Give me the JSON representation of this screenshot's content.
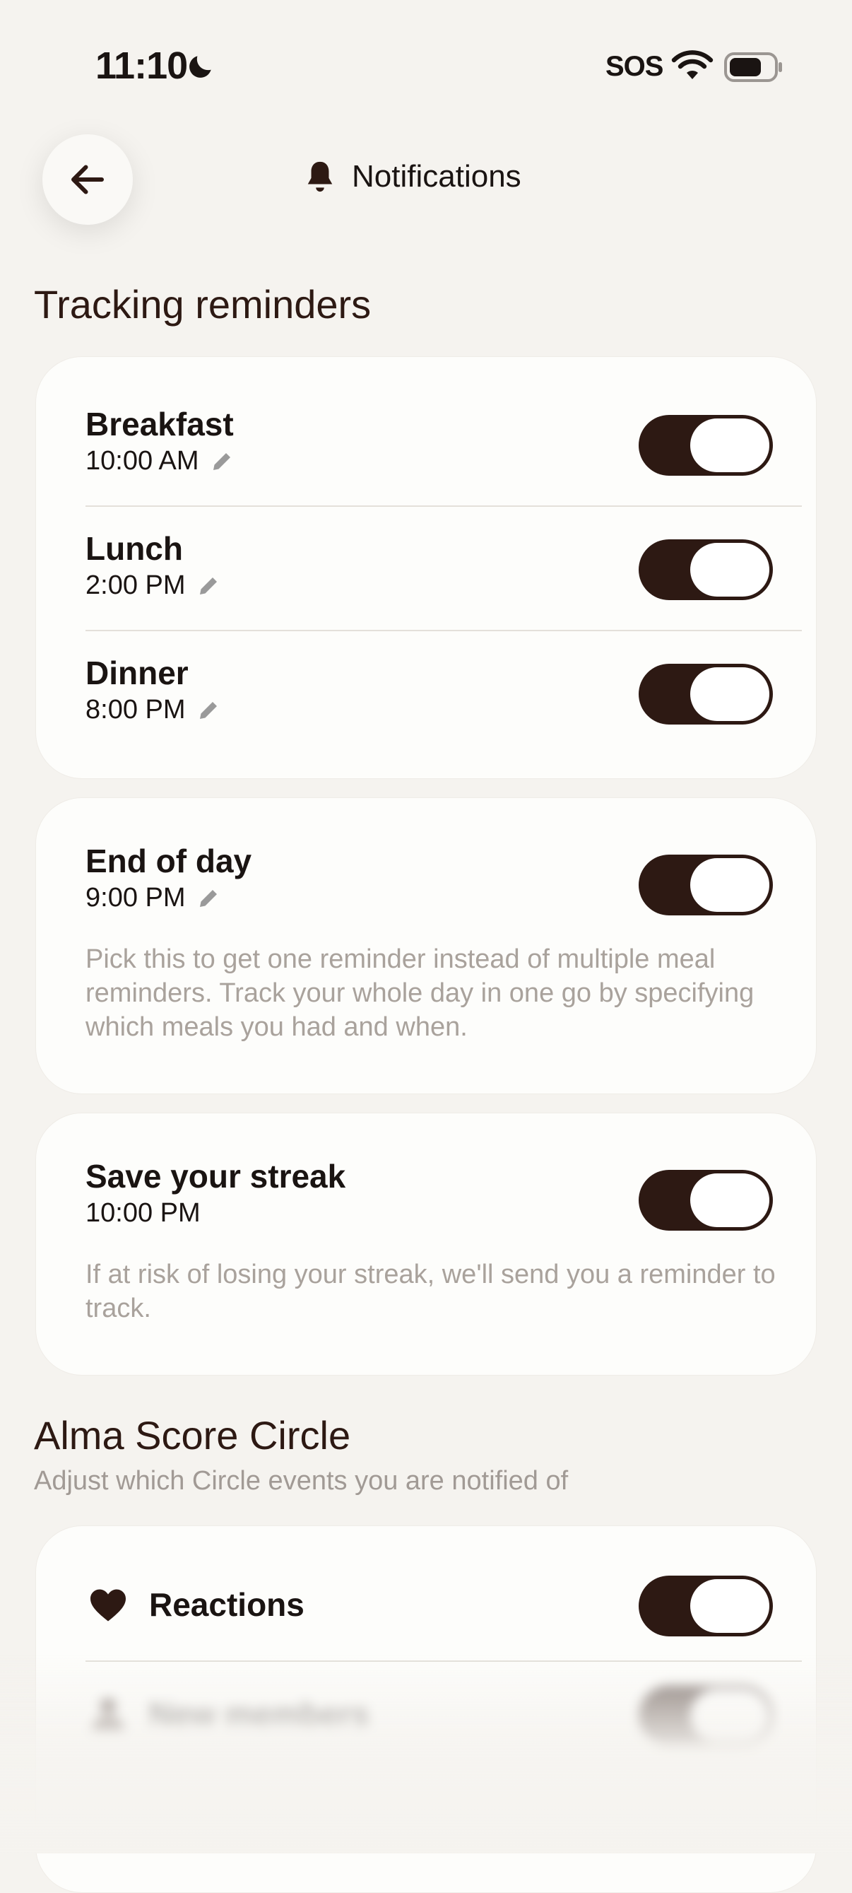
{
  "status_bar": {
    "time": "11:10",
    "sos": "SOS"
  },
  "header": {
    "title": "Notifications",
    "back_icon": "arrow-left-icon",
    "bell_icon": "bell-icon"
  },
  "tracking": {
    "heading": "Tracking reminders",
    "meals": [
      {
        "label": "Breakfast",
        "time": "10:00 AM",
        "enabled": true
      },
      {
        "label": "Lunch",
        "time": "2:00 PM",
        "enabled": true
      },
      {
        "label": "Dinner",
        "time": "8:00 PM",
        "enabled": true
      }
    ],
    "end_of_day": {
      "label": "End of day",
      "time": "9:00 PM",
      "enabled": true,
      "description": "Pick this to get one reminder instead of multiple meal reminders. Track your whole day in one go by specifying which meals you had and when."
    },
    "streak": {
      "label": "Save your streak",
      "time": "10:00 PM",
      "enabled": true,
      "description": "If at risk of losing your streak, we'll send you a reminder to track."
    }
  },
  "circle": {
    "heading": "Alma Score Circle",
    "subheading": "Adjust which Circle events you are notified of",
    "items": [
      {
        "label": "Reactions",
        "icon": "heart-icon",
        "enabled": true
      },
      {
        "label": "New members",
        "icon": "person-icon",
        "enabled": true
      }
    ]
  },
  "colors": {
    "background": "#f5f3ef",
    "accent": "#2d1913",
    "muted_text": "#a9a29c",
    "card": "#fdfdfb"
  }
}
